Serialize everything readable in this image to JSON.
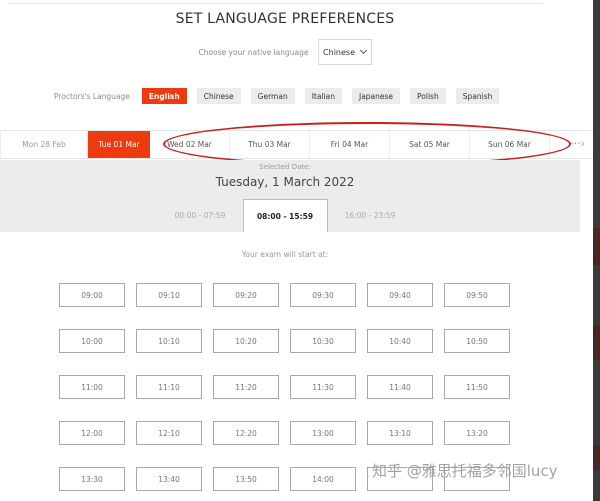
{
  "title": "SET LANGUAGE PREFERENCES",
  "native_language": {
    "label": "Choose your native language",
    "selected": "Chinese"
  },
  "proctor_language": {
    "label": "Proctors's Language",
    "options": [
      {
        "label": "English",
        "active": true
      },
      {
        "label": "Chinese",
        "active": false
      },
      {
        "label": "German",
        "active": false
      },
      {
        "label": "Italian",
        "active": false
      },
      {
        "label": "Japanese",
        "active": false
      },
      {
        "label": "Polish",
        "active": false
      },
      {
        "label": "Spanish",
        "active": false
      }
    ]
  },
  "dates": [
    {
      "label": "Mon 28 Feb",
      "active": false
    },
    {
      "label": "Tue 01 Mar",
      "active": true
    },
    {
      "label": "Wed 02 Mar",
      "active": false
    },
    {
      "label": "Thu 03 Mar",
      "active": false
    },
    {
      "label": "Fri 04 Mar",
      "active": false
    },
    {
      "label": "Sat 05 Mar",
      "active": false
    },
    {
      "label": "Sun 06 Mar",
      "active": false
    }
  ],
  "next_icon": "chevron-right-icon",
  "selected_date": {
    "label": "Selected Date:",
    "value": "Tuesday, 1 March 2022"
  },
  "time_ranges": [
    {
      "label": "00:00 - 07:59",
      "active": false
    },
    {
      "label": "08:00 - 15:59",
      "active": true
    },
    {
      "label": "16:00 - 23:59",
      "active": false
    }
  ],
  "start_label": "Your exam will start at:",
  "slots": [
    "09:00",
    "09:10",
    "09:20",
    "09:30",
    "09:40",
    "09:50",
    "10:00",
    "10:10",
    "10:20",
    "10:30",
    "10:40",
    "10:50",
    "11:00",
    "11:10",
    "11:20",
    "11:30",
    "11:40",
    "11:50",
    "12:00",
    "12:10",
    "12:20",
    "13:00",
    "13:10",
    "13:20",
    "13:30",
    "13:40",
    "13:50",
    "14:00",
    "",
    ""
  ],
  "watermark": "知乎 @雅思托福多邻国lucy",
  "colors": {
    "accent": "#ee3a0f",
    "annotation": "#c8201a"
  }
}
